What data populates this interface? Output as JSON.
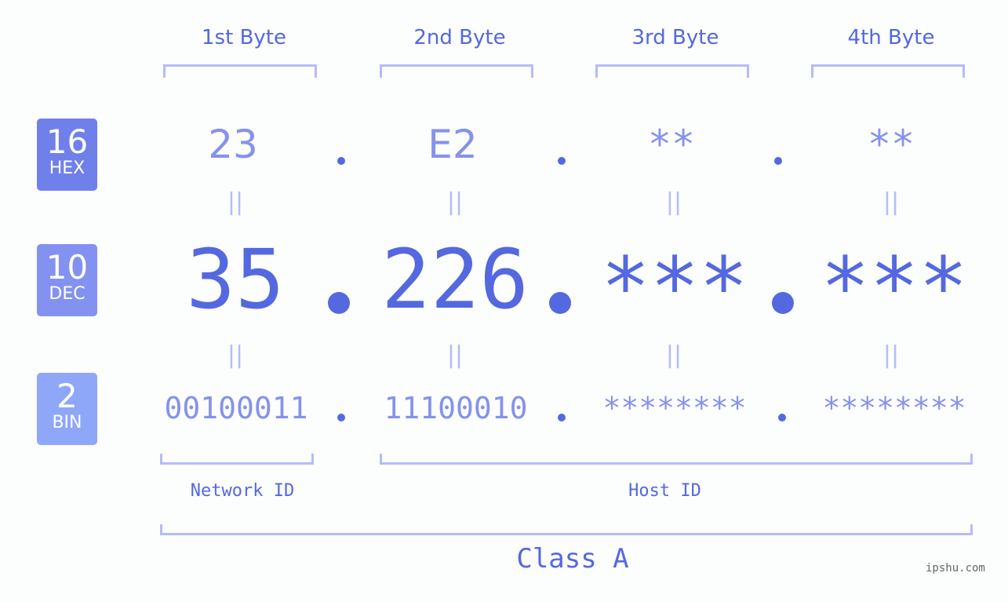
{
  "bytes": [
    {
      "label": "1st Byte",
      "hex": "23",
      "dec": "35",
      "bin": "00100011"
    },
    {
      "label": "2nd Byte",
      "hex": "E2",
      "dec": "226",
      "bin": "11100010"
    },
    {
      "label": "3rd Byte",
      "hex": "**",
      "dec": "***",
      "bin": "********"
    },
    {
      "label": "4th Byte",
      "hex": "**",
      "dec": "***",
      "bin": "********"
    }
  ],
  "badges": {
    "hex": {
      "num": "16",
      "label": "HEX",
      "color": "#7080ea"
    },
    "dec": {
      "num": "10",
      "label": "DEC",
      "color": "#8392f0"
    },
    "bin": {
      "num": "2",
      "label": "BIN",
      "color": "#8ea7f8"
    }
  },
  "equals_symbol": "||",
  "network_id_label": "Network ID",
  "host_id_label": "Host ID",
  "class_label": "Class A",
  "watermark": "ipshu.com"
}
